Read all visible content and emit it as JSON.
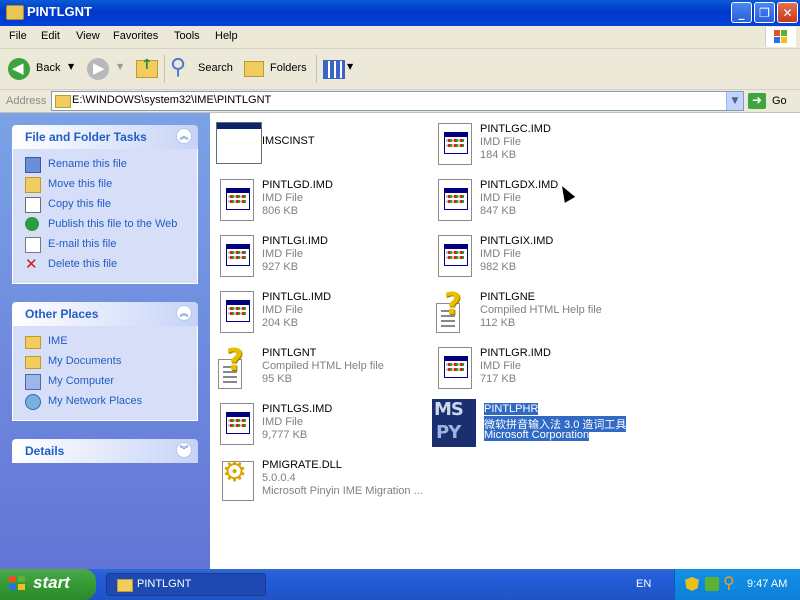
{
  "window": {
    "title": "PINTLGNT"
  },
  "menu": [
    "File",
    "Edit",
    "View",
    "Favorites",
    "Tools",
    "Help"
  ],
  "toolbar": {
    "back": "Back",
    "search": "Search",
    "folders": "Folders"
  },
  "address": {
    "label": "Address",
    "path": "E:\\WINDOWS\\system32\\IME\\PINTLGNT",
    "go": "Go"
  },
  "sidebar": {
    "tasks": {
      "title": "File and Folder Tasks",
      "items": [
        "Rename this file",
        "Move this file",
        "Copy this file",
        "Publish this file to the Web",
        "E-mail this file",
        "Delete this file"
      ]
    },
    "places": {
      "title": "Other Places",
      "items": [
        "IME",
        "My Documents",
        "My Computer",
        "My Network Places"
      ]
    },
    "details": {
      "title": "Details"
    }
  },
  "files": [
    {
      "name": "IMSCINST",
      "line2": "",
      "line3": "",
      "icon": "app-window-icon"
    },
    {
      "name": "PINTLGC.IMD",
      "line2": "IMD File",
      "line3": "184 KB",
      "icon": "imd-file-icon"
    },
    {
      "name": "PINTLGD.IMD",
      "line2": "IMD File",
      "line3": "806 KB",
      "icon": "imd-file-icon"
    },
    {
      "name": "PINTLGDX.IMD",
      "line2": "IMD File",
      "line3": "847 KB",
      "icon": "imd-file-icon"
    },
    {
      "name": "PINTLGI.IMD",
      "line2": "IMD File",
      "line3": "927 KB",
      "icon": "imd-file-icon"
    },
    {
      "name": "PINTLGIX.IMD",
      "line2": "IMD File",
      "line3": "982 KB",
      "icon": "imd-file-icon"
    },
    {
      "name": "PINTLGL.IMD",
      "line2": "IMD File",
      "line3": "204 KB",
      "icon": "imd-file-icon"
    },
    {
      "name": "PINTLGNE",
      "line2": "Compiled HTML Help file",
      "line3": "112 KB",
      "icon": "help-file-icon"
    },
    {
      "name": "PINTLGNT",
      "line2": "Compiled HTML Help file",
      "line3": "95 KB",
      "icon": "help-file-icon"
    },
    {
      "name": "PINTLGR.IMD",
      "line2": "IMD File",
      "line3": "717 KB",
      "icon": "imd-file-icon"
    },
    {
      "name": "PINTLGS.IMD",
      "line2": "IMD File",
      "line3": "9,777 KB",
      "icon": "imd-file-icon"
    },
    {
      "name": "PINTLPHR",
      "line2": "微软拼音输入法 3.0 造词工具",
      "line3": "Microsoft Corporation",
      "icon": "mspy-icon",
      "selected": true
    },
    {
      "name": "PMIGRATE.DLL",
      "line2": "5.0.0.4",
      "line3": "Microsoft Pinyin IME Migration ...",
      "icon": "dll-gear-icon"
    }
  ],
  "taskbar": {
    "start": "start",
    "task": "PINTLGNT",
    "lang": "EN",
    "clock": "9:47 AM"
  }
}
